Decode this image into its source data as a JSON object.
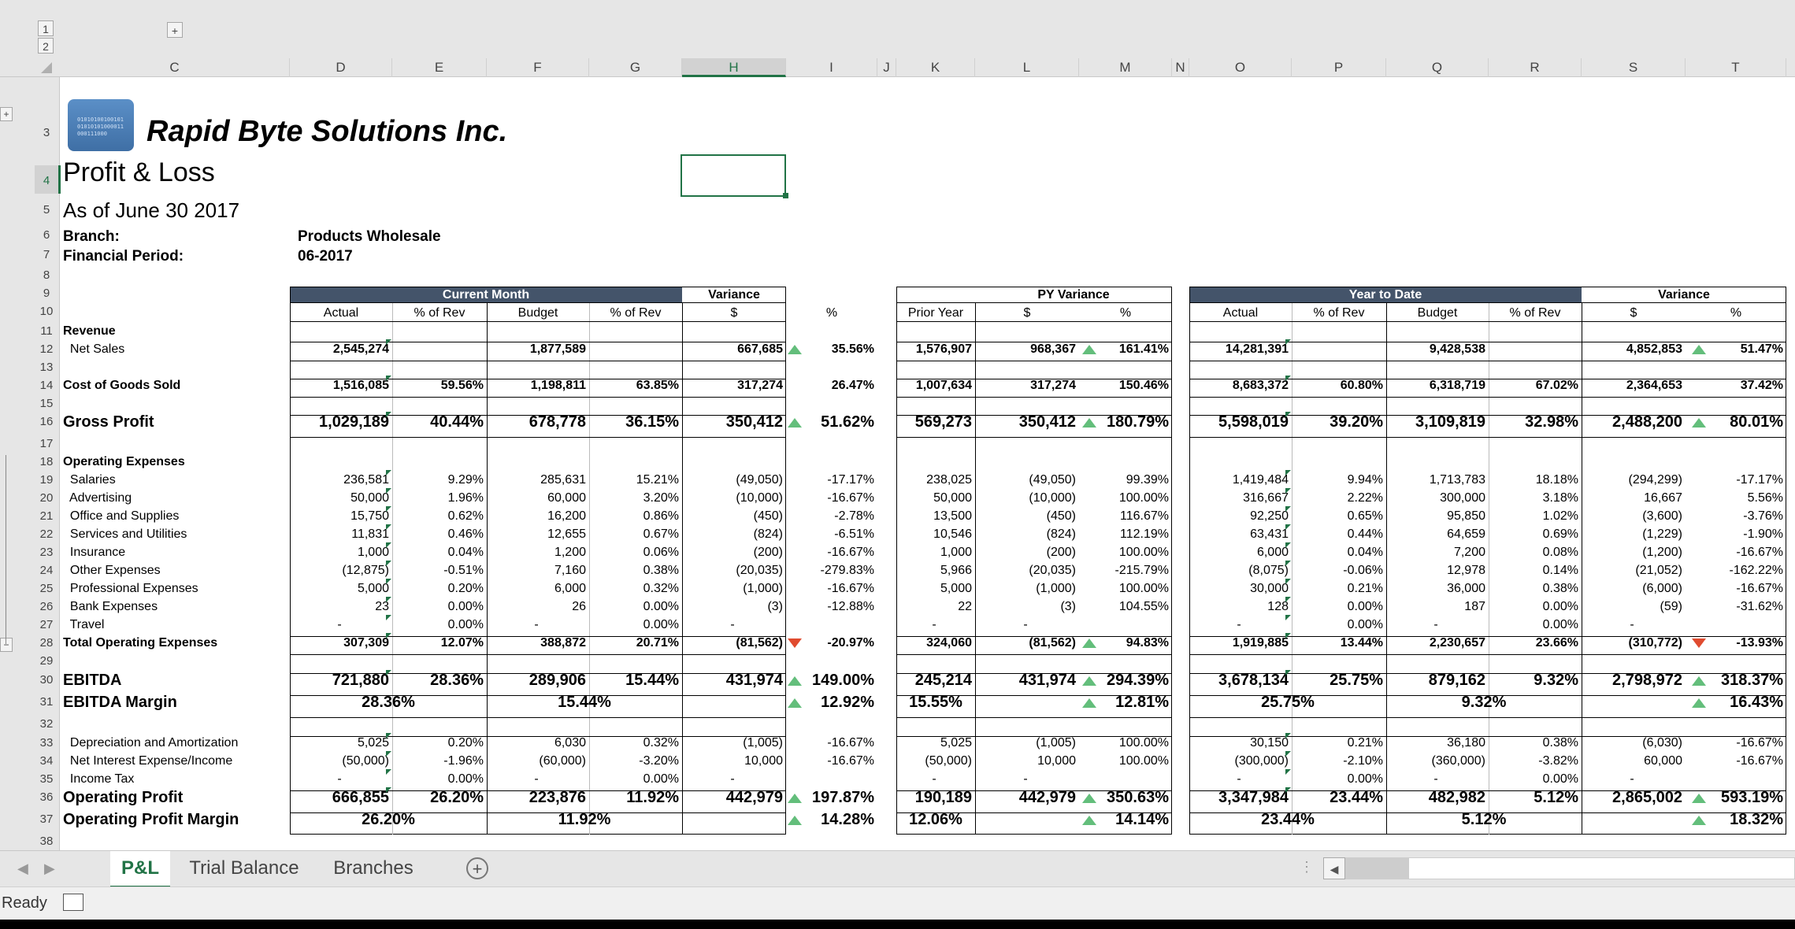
{
  "window": {
    "status": "Ready"
  },
  "outline": {
    "level1": "1",
    "level2": "2",
    "expand": "+",
    "collapse": "−"
  },
  "column_letters": [
    "C",
    "D",
    "E",
    "F",
    "G",
    "H",
    "I",
    "J",
    "K",
    "L",
    "M",
    "N",
    "O",
    "P",
    "Q",
    "R",
    "S",
    "T"
  ],
  "selected_cell": "H4",
  "company": {
    "name": "Rapid Byte Solutions Inc.",
    "logo_text": "0101010010010101010101000011000111000"
  },
  "report": {
    "title": "Profit & Loss",
    "as_of": "As of June 30 2017",
    "branch_label": "Branch:",
    "branch_value": "Products Wholesale",
    "period_label": "Financial Period:",
    "period_value": "06-2017"
  },
  "section_headers": {
    "current_month": "Current Month",
    "variance": "Variance",
    "py_variance": "PY Variance",
    "year_to_date": "Year to Date",
    "ytd_variance": "Variance"
  },
  "column_headers": [
    "Actual",
    "% of Rev",
    "Budget",
    "% of Rev",
    "$",
    "%",
    "Prior Year",
    "$",
    "%",
    "Actual",
    "% of Rev",
    "Budget",
    "% of Rev",
    "$",
    "%"
  ],
  "rows": [
    {
      "row": 11,
      "label": "Revenue",
      "bold": true,
      "values": []
    },
    {
      "row": 12,
      "label": "  Net Sales",
      "bold": false,
      "boldvals": true,
      "values": [
        "2,545,274",
        "",
        "1,877,589",
        "",
        "667,685",
        "35.56%",
        "1,576,907",
        "968,367",
        "161.41%",
        "14,281,391",
        "",
        "9,428,538",
        "",
        "4,852,853",
        "51.47%"
      ],
      "arrows": {
        "v": "up",
        "py": "up",
        "ytd": "up"
      }
    },
    {
      "row": 14,
      "label": "Cost of Goods Sold",
      "bold": true,
      "boldvals": true,
      "values": [
        "1,516,085",
        "59.56%",
        "1,198,811",
        "63.85%",
        "317,274",
        "26.47%",
        "1,007,634",
        "317,274",
        "150.46%",
        "8,683,372",
        "60.80%",
        "6,318,719",
        "67.02%",
        "2,364,653",
        "37.42%"
      ]
    },
    {
      "row": 16,
      "label": "Gross Profit",
      "big": true,
      "values": [
        "1,029,189",
        "40.44%",
        "678,778",
        "36.15%",
        "350,412",
        "51.62%",
        "569,273",
        "350,412",
        "180.79%",
        "5,598,019",
        "39.20%",
        "3,109,819",
        "32.98%",
        "2,488,200",
        "80.01%"
      ],
      "arrows": {
        "v": "up",
        "py": "up",
        "ytd": "up"
      }
    },
    {
      "row": 18,
      "label": "Operating Expenses",
      "bold": true,
      "values": []
    },
    {
      "row": 19,
      "label": "  Salaries",
      "values": [
        "236,581",
        "9.29%",
        "285,631",
        "15.21%",
        "(49,050)",
        "-17.17%",
        "238,025",
        "(49,050)",
        "99.39%",
        "1,419,484",
        "9.94%",
        "1,713,783",
        "18.18%",
        "(294,299)",
        "-17.17%"
      ]
    },
    {
      "row": 20,
      "label": "  Advertising",
      "values": [
        "50,000",
        "1.96%",
        "60,000",
        "3.20%",
        "(10,000)",
        "-16.67%",
        "50,000",
        "(10,000)",
        "100.00%",
        "316,667",
        "2.22%",
        "300,000",
        "3.18%",
        "16,667",
        "5.56%"
      ]
    },
    {
      "row": 21,
      "label": "  Office and Supplies",
      "values": [
        "15,750",
        "0.62%",
        "16,200",
        "0.86%",
        "(450)",
        "-2.78%",
        "13,500",
        "(450)",
        "116.67%",
        "92,250",
        "0.65%",
        "95,850",
        "1.02%",
        "(3,600)",
        "-3.76%"
      ]
    },
    {
      "row": 22,
      "label": "  Services and Utilities",
      "values": [
        "11,831",
        "0.46%",
        "12,655",
        "0.67%",
        "(824)",
        "-6.51%",
        "10,546",
        "(824)",
        "112.19%",
        "63,431",
        "0.44%",
        "64,659",
        "0.69%",
        "(1,229)",
        "-1.90%"
      ]
    },
    {
      "row": 23,
      "label": "  Insurance",
      "values": [
        "1,000",
        "0.04%",
        "1,200",
        "0.06%",
        "(200)",
        "-16.67%",
        "1,000",
        "(200)",
        "100.00%",
        "6,000",
        "0.04%",
        "7,200",
        "0.08%",
        "(1,200)",
        "-16.67%"
      ]
    },
    {
      "row": 24,
      "label": "  Other Expenses",
      "values": [
        "(12,875)",
        "-0.51%",
        "7,160",
        "0.38%",
        "(20,035)",
        "-279.83%",
        "5,966",
        "(20,035)",
        "-215.79%",
        "(8,075)",
        "-0.06%",
        "12,978",
        "0.14%",
        "(21,052)",
        "-162.22%"
      ]
    },
    {
      "row": 25,
      "label": "  Professional Expenses",
      "values": [
        "5,000",
        "0.20%",
        "6,000",
        "0.32%",
        "(1,000)",
        "-16.67%",
        "5,000",
        "(1,000)",
        "100.00%",
        "30,000",
        "0.21%",
        "36,000",
        "0.38%",
        "(6,000)",
        "-16.67%"
      ]
    },
    {
      "row": 26,
      "label": "  Bank Expenses",
      "values": [
        "23",
        "0.00%",
        "26",
        "0.00%",
        "(3)",
        "-12.88%",
        "22",
        "(3)",
        "104.55%",
        "128",
        "0.00%",
        "187",
        "0.00%",
        "(59)",
        "-31.62%"
      ]
    },
    {
      "row": 27,
      "label": "  Travel",
      "values": [
        "-",
        "0.00%",
        "-",
        "0.00%",
        "-",
        "",
        "-",
        "-",
        "",
        "-",
        "0.00%",
        "-",
        "0.00%",
        "-",
        ""
      ]
    },
    {
      "row": 28,
      "label": "Total Operating Expenses",
      "bold": true,
      "boldvals": true,
      "values": [
        "307,309",
        "12.07%",
        "388,872",
        "20.71%",
        "(81,562)",
        "-20.97%",
        "324,060",
        "(81,562)",
        "94.83%",
        "1,919,885",
        "13.44%",
        "2,230,657",
        "23.66%",
        "(310,772)",
        "-13.93%"
      ],
      "arrows": {
        "v": "down",
        "py": "up",
        "ytd": "down"
      }
    },
    {
      "row": 30,
      "label": "EBITDA",
      "big": true,
      "values": [
        "721,880",
        "28.36%",
        "289,906",
        "15.44%",
        "431,974",
        "149.00%",
        "245,214",
        "431,974",
        "294.39%",
        "3,678,134",
        "25.75%",
        "879,162",
        "9.32%",
        "2,798,972",
        "318.37%"
      ],
      "arrows": {
        "v": "up",
        "py": "up",
        "ytd": "up"
      }
    },
    {
      "row": 31,
      "label": "EBITDA Margin",
      "big": true,
      "values": [
        "28.36%",
        "",
        "15.44%",
        "",
        "",
        "12.92%",
        "15.55%",
        "",
        "12.81%",
        "25.75%",
        "",
        "9.32%",
        "",
        "",
        "16.43%"
      ],
      "arrows": {
        "v": "up",
        "py": "up",
        "ytd": "up"
      },
      "centered": true
    },
    {
      "row": 33,
      "label": "  Depreciation and Amortization",
      "values": [
        "5,025",
        "0.20%",
        "6,030",
        "0.32%",
        "(1,005)",
        "-16.67%",
        "5,025",
        "(1,005)",
        "100.00%",
        "30,150",
        "0.21%",
        "36,180",
        "0.38%",
        "(6,030)",
        "-16.67%"
      ]
    },
    {
      "row": 34,
      "label": "  Net Interest Expense/Income",
      "values": [
        "(50,000)",
        "-1.96%",
        "(60,000)",
        "-3.20%",
        "10,000",
        "-16.67%",
        "(50,000)",
        "10,000",
        "100.00%",
        "(300,000)",
        "-2.10%",
        "(360,000)",
        "-3.82%",
        "60,000",
        "-16.67%"
      ]
    },
    {
      "row": 35,
      "label": "  Income Tax",
      "values": [
        "-",
        "0.00%",
        "-",
        "0.00%",
        "-",
        "",
        "-",
        "-",
        "",
        "-",
        "0.00%",
        "-",
        "0.00%",
        "-",
        ""
      ]
    },
    {
      "row": 36,
      "label": "Operating Profit",
      "big": true,
      "values": [
        "666,855",
        "26.20%",
        "223,876",
        "11.92%",
        "442,979",
        "197.87%",
        "190,189",
        "442,979",
        "350.63%",
        "3,347,984",
        "23.44%",
        "482,982",
        "5.12%",
        "2,865,002",
        "593.19%"
      ],
      "arrows": {
        "v": "up",
        "py": "up",
        "ytd": "up"
      }
    },
    {
      "row": 37,
      "label": "Operating Profit Margin",
      "big": true,
      "values": [
        "26.20%",
        "",
        "11.92%",
        "",
        "",
        "14.28%",
        "12.06%",
        "",
        "14.14%",
        "23.44%",
        "",
        "5.12%",
        "",
        "",
        "18.32%"
      ],
      "arrows": {
        "v": "up",
        "py": "up",
        "ytd": "up"
      },
      "centered": true
    }
  ],
  "sheet_tabs": [
    "P&L",
    "Trial Balance",
    "Branches"
  ],
  "active_tab": "P&L",
  "colors": {
    "header_fill": "#44546a",
    "accent": "#217346",
    "arrow_up": "#63be7b",
    "arrow_down": "#e04b2f"
  }
}
